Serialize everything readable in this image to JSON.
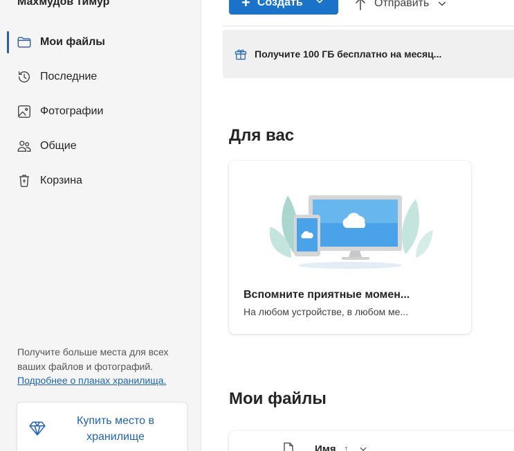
{
  "user": {
    "name": "Махмудов тимур"
  },
  "sidebar": {
    "items": [
      {
        "label": "Мои файлы",
        "icon": "folder-icon",
        "active": true
      },
      {
        "label": "Последние",
        "icon": "history-icon",
        "active": false
      },
      {
        "label": "Фотографии",
        "icon": "image-icon",
        "active": false
      },
      {
        "label": "Общие",
        "icon": "people-icon",
        "active": false
      },
      {
        "label": "Корзина",
        "icon": "recycle-bin-icon",
        "active": false
      }
    ],
    "promo": {
      "text": "Получите больше места для всех ваших файлов и фотографий.",
      "link": "Подробнее о планах хранилища.",
      "buy_label": "Купить место в хранилище"
    }
  },
  "toolbar": {
    "create_label": "Создать",
    "send_label": "Отправить"
  },
  "banner": {
    "text": "Получите 100 ГБ бесплатно на месяц..."
  },
  "for_you": {
    "title": "Для вас",
    "card_title": "Вспомните приятные момен...",
    "card_subtitle": "На любом устройстве, в любом ме..."
  },
  "my_files": {
    "title": "Мои файлы",
    "column_name": "Имя",
    "sort_indicator": "↑"
  },
  "colors": {
    "accent": "#1a73c8",
    "link": "#1e63b8",
    "sidebar_bg": "#f5f5f5"
  }
}
